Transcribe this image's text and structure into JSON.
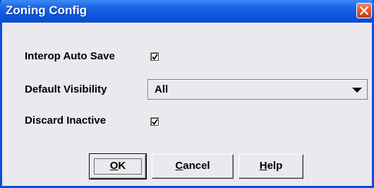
{
  "window": {
    "title": "Zoning Config"
  },
  "form": {
    "interop_auto_save": {
      "label": "Interop Auto Save",
      "checked": true
    },
    "default_visibility": {
      "label": "Default Visibility",
      "value": "All"
    },
    "discard_inactive": {
      "label": "Discard Inactive",
      "checked": true
    }
  },
  "buttons": {
    "ok": {
      "mnemonic": "O",
      "rest": "K"
    },
    "cancel": {
      "mnemonic": "C",
      "rest": "ancel"
    },
    "help": {
      "mnemonic": "H",
      "rest": "elp"
    }
  },
  "colors": {
    "title_bar": "#0b55de",
    "close_button": "#e04a1e",
    "dialog_background": "#ebe9ed"
  },
  "icons": {
    "close": "close-icon",
    "dropdown": "chevron-down-icon",
    "check": "check-icon"
  }
}
